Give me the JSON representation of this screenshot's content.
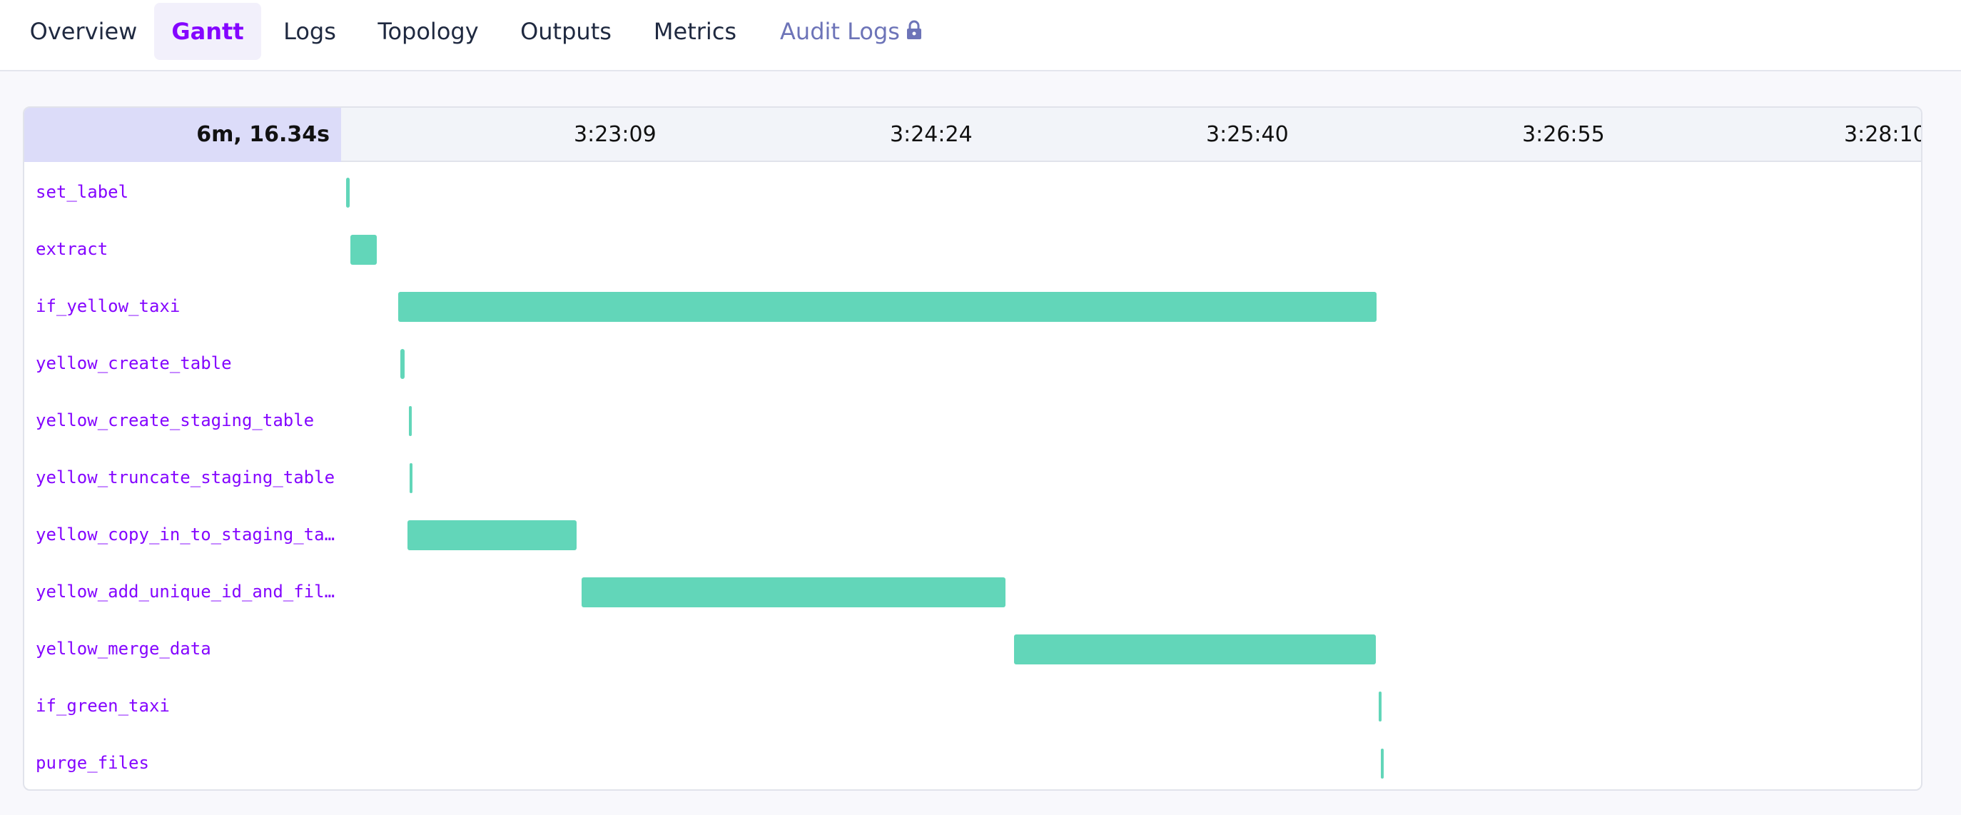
{
  "tabs": [
    {
      "label": "Overview",
      "active": false,
      "locked": false
    },
    {
      "label": "Gantt",
      "active": true,
      "locked": false
    },
    {
      "label": "Logs",
      "active": false,
      "locked": false
    },
    {
      "label": "Topology",
      "active": false,
      "locked": false
    },
    {
      "label": "Outputs",
      "active": false,
      "locked": false
    },
    {
      "label": "Metrics",
      "active": false,
      "locked": false
    },
    {
      "label": "Audit Logs",
      "active": false,
      "locked": true,
      "icon": "lock-icon"
    }
  ],
  "gantt": {
    "total_duration": "6m, 16.34s",
    "ticks": [
      "3:23:09",
      "3:24:24",
      "3:25:40",
      "3:26:55",
      "3:28:10"
    ],
    "bar_color": "#62d6b9",
    "tasks": [
      {
        "name": "set_label",
        "start_s": 2.3,
        "end_s": 3.2
      },
      {
        "name": "extract",
        "start_s": 3.4,
        "end_s": 9.7
      },
      {
        "name": "if_yellow_taxi",
        "start_s": 14.8,
        "end_s": 247.2
      },
      {
        "name": "yellow_create_table",
        "start_s": 15.2,
        "end_s": 16.2
      },
      {
        "name": "yellow_create_staging_table",
        "start_s": 17.3,
        "end_s": 17.6
      },
      {
        "name": "yellow_truncate_staging_table",
        "start_s": 17.4,
        "end_s": 17.8
      },
      {
        "name": "yellow_copy_in_to_staging_ta…",
        "start_s": 17.0,
        "end_s": 57.2
      },
      {
        "name": "yellow_add_unique_id_and_fil…",
        "start_s": 58.3,
        "end_s": 159.0
      },
      {
        "name": "yellow_merge_data",
        "start_s": 161.0,
        "end_s": 246.9
      },
      {
        "name": "if_green_taxi",
        "start_s": 247.7,
        "end_s": 248.3
      },
      {
        "name": "purge_files",
        "start_s": 248.1,
        "end_s": 248.5
      }
    ]
  }
}
